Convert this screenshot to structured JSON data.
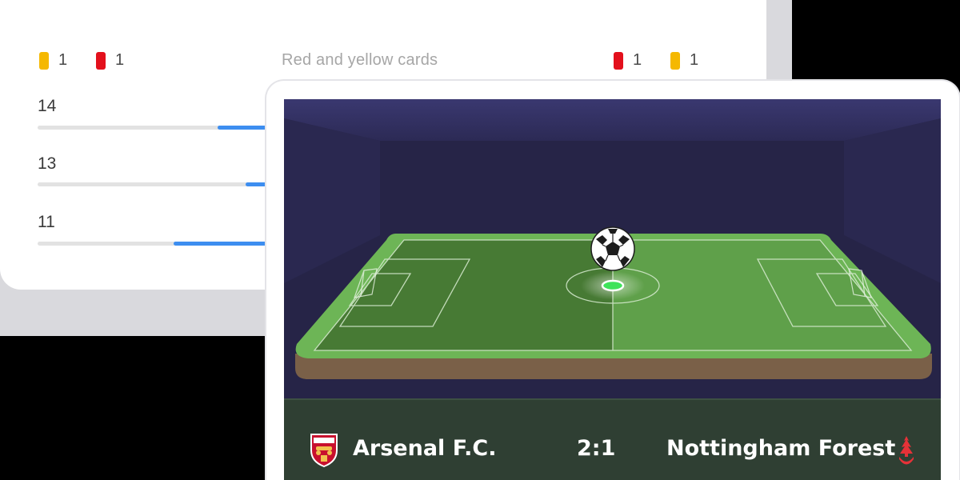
{
  "stats_card": {
    "rings": [
      {
        "name": "home",
        "color": "#3d8ef0"
      },
      {
        "name": "center",
        "color": "#f2b705"
      },
      {
        "name": "away",
        "color": "#3d8ef0"
      }
    ],
    "cards_label": "Red and yellow cards",
    "home_cards": [
      {
        "type": "yellow",
        "color": "#f5b800",
        "count": "1"
      },
      {
        "type": "red",
        "color": "#e3101c",
        "count": "1"
      }
    ],
    "away_cards": [
      {
        "type": "red",
        "color": "#e3101c",
        "count": "1"
      },
      {
        "type": "yellow",
        "color": "#f5b800",
        "count": "1"
      }
    ],
    "stat_rows": [
      {
        "value": "14",
        "fill_fraction": 0.3
      },
      {
        "value": "13",
        "fill_fraction": 0.3
      },
      {
        "value": "11",
        "fill_fraction": 0.3
      }
    ]
  },
  "match": {
    "home_team": "Arsenal F.C.",
    "away_team": "Nottingham Forest",
    "score": "2:1",
    "home_crest_icon": "arsenal-crest-icon",
    "away_crest_icon": "nottingham-forest-crest-icon",
    "colors": {
      "stadium": "#262447",
      "pitch_dark": "#477a34",
      "pitch_light": "#5fa04a",
      "pitch_border": "#6db556",
      "soil": "#7a6048",
      "scoreboard": "#2f3f33",
      "ball_marker": "#3ee35a"
    }
  }
}
